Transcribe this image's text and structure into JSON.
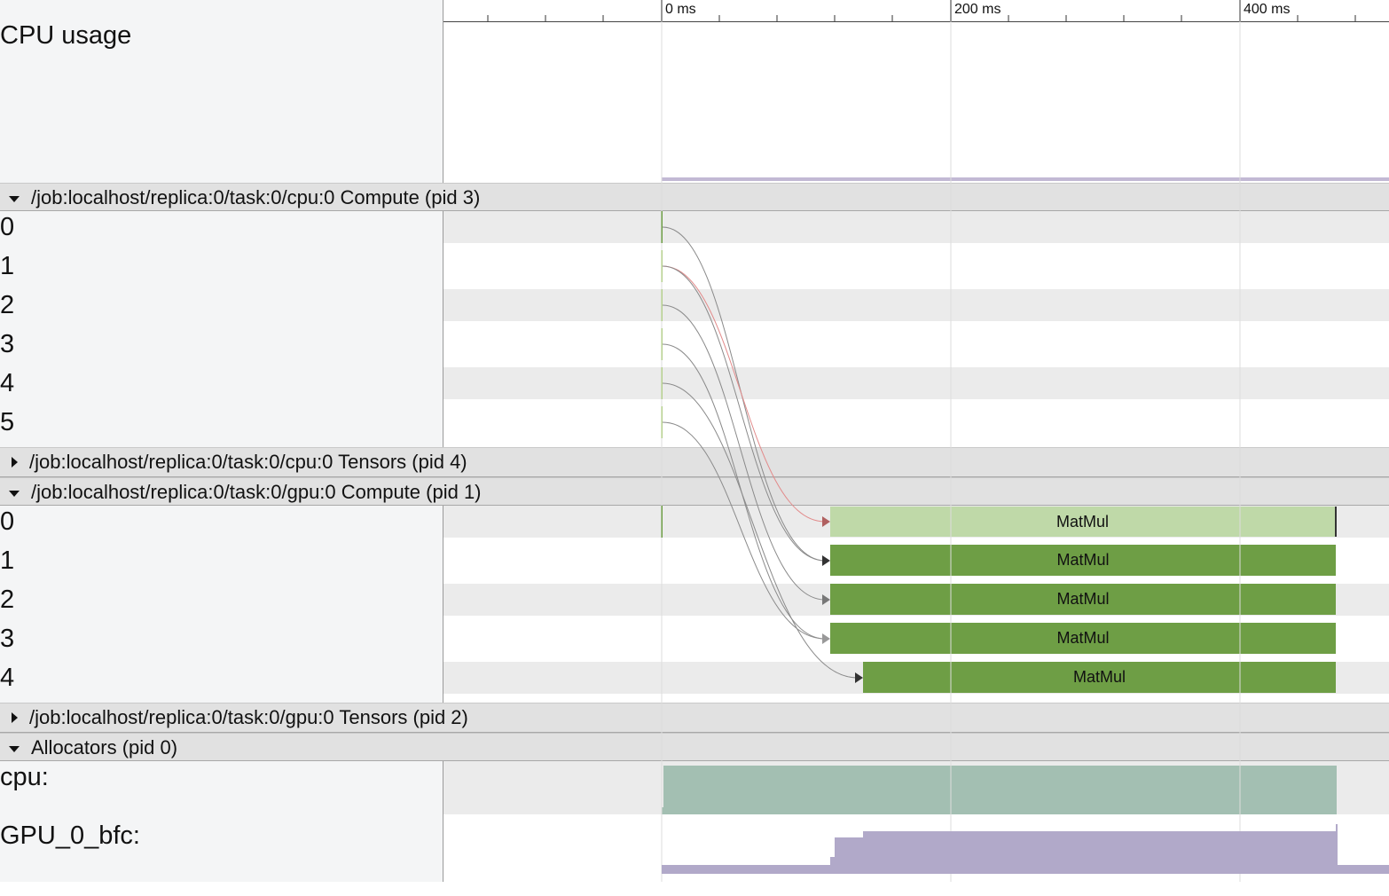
{
  "ruler": {
    "labels": [
      "0 ms",
      "200 ms",
      "400 ms"
    ]
  },
  "cpu_usage": {
    "label": "CPU usage"
  },
  "groups": [
    {
      "title": "/job:localhost/replica:0/task:0/cpu:0 Compute (pid 3)",
      "expanded": true,
      "rows": [
        "0",
        "1",
        "2",
        "3",
        "4",
        "5"
      ]
    },
    {
      "title": "/job:localhost/replica:0/task:0/cpu:0 Tensors (pid 4)",
      "expanded": false,
      "rows": []
    },
    {
      "title": "/job:localhost/replica:0/task:0/gpu:0 Compute (pid 1)",
      "expanded": true,
      "rows": [
        "0",
        "1",
        "2",
        "3",
        "4"
      ]
    },
    {
      "title": "/job:localhost/replica:0/task:0/gpu:0 Tensors (pid 2)",
      "expanded": false,
      "rows": []
    },
    {
      "title": "Allocators (pid 0)",
      "expanded": true,
      "rows": []
    }
  ],
  "gpu_slices": [
    {
      "label": "MatMul",
      "row": 0,
      "selected": true
    },
    {
      "label": "MatMul",
      "row": 1,
      "selected": false
    },
    {
      "label": "MatMul",
      "row": 2,
      "selected": false
    },
    {
      "label": "MatMul",
      "row": 3,
      "selected": false
    },
    {
      "label": "MatMul",
      "row": 4,
      "selected": false
    }
  ],
  "allocators": {
    "cpu_label": "cpu:",
    "gpu_label": "GPU_0_bfc:"
  },
  "colors": {
    "slice": "#6e9e45",
    "slice_selected": "#bfd9a8",
    "cpu_alloc": "#a3bfb2",
    "gpu_alloc": "#b1a9c9",
    "flow": "#8a8a8a",
    "flow_highlight": "#e28a8a"
  }
}
